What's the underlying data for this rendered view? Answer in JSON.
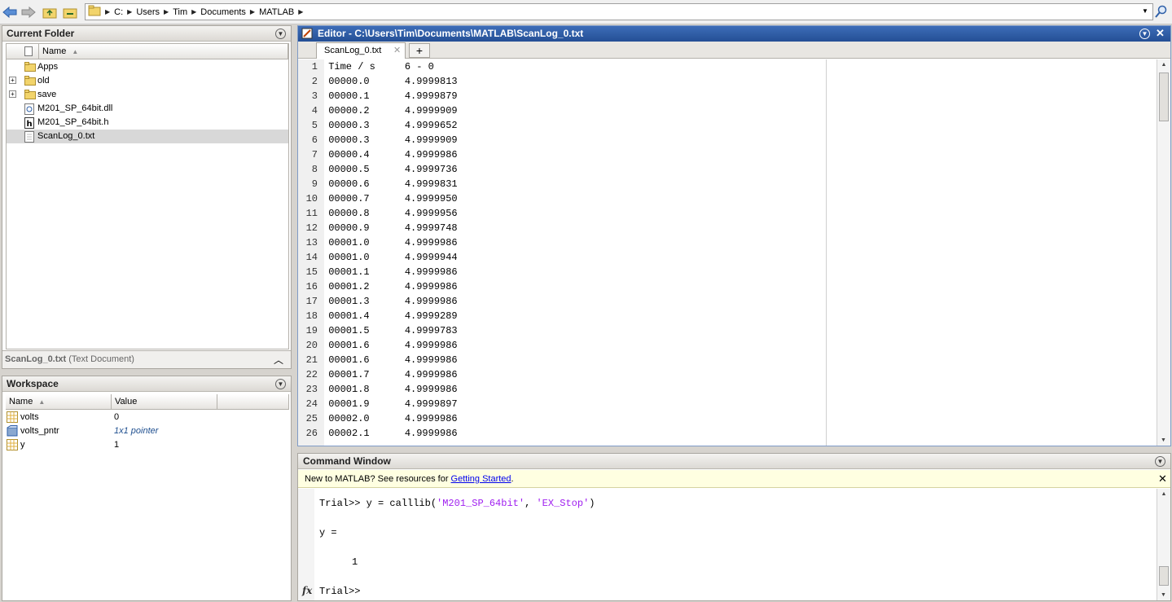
{
  "address": {
    "crumbs": [
      "C:",
      "Users",
      "Tim",
      "Documents",
      "MATLAB"
    ]
  },
  "current_folder": {
    "title": "Current Folder",
    "col_name": "Name",
    "items": [
      {
        "name": "Apps",
        "type": "folder",
        "expandable": false
      },
      {
        "name": "old",
        "type": "folder",
        "expandable": true
      },
      {
        "name": "save",
        "type": "folder",
        "expandable": true
      },
      {
        "name": "M201_SP_64bit.dll",
        "type": "dll",
        "expandable": false
      },
      {
        "name": "M201_SP_64bit.h",
        "type": "header",
        "expandable": false
      },
      {
        "name": "ScanLog_0.txt",
        "type": "text",
        "expandable": false
      }
    ],
    "details_file": "ScanLog_0.txt",
    "details_type": "(Text Document)"
  },
  "workspace": {
    "title": "Workspace",
    "col_name": "Name",
    "col_value": "Value",
    "vars": [
      {
        "name": "volts",
        "value": "0"
      },
      {
        "name": "volts_pntr",
        "value": "1x1 pointer"
      },
      {
        "name": "y",
        "value": "1"
      }
    ]
  },
  "editor": {
    "title": "Editor - C:\\Users\\Tim\\Documents\\MATLAB\\ScanLog_0.txt",
    "tab": "ScanLog_0.txt",
    "lines": [
      {
        "n": "1",
        "text": " Time / s     6 - 0"
      },
      {
        "n": "2",
        "text": " 00000.0      4.9999813"
      },
      {
        "n": "3",
        "text": " 00000.1      4.9999879"
      },
      {
        "n": "4",
        "text": " 00000.2      4.9999909"
      },
      {
        "n": "5",
        "text": " 00000.3      4.9999652"
      },
      {
        "n": "6",
        "text": " 00000.3      4.9999909"
      },
      {
        "n": "7",
        "text": " 00000.4      4.9999986"
      },
      {
        "n": "8",
        "text": " 00000.5      4.9999736"
      },
      {
        "n": "9",
        "text": " 00000.6      4.9999831"
      },
      {
        "n": "10",
        "text": " 00000.7      4.9999950"
      },
      {
        "n": "11",
        "text": " 00000.8      4.9999956"
      },
      {
        "n": "12",
        "text": " 00000.9      4.9999748"
      },
      {
        "n": "13",
        "text": " 00001.0      4.9999986"
      },
      {
        "n": "14",
        "text": " 00001.0      4.9999944"
      },
      {
        "n": "15",
        "text": " 00001.1      4.9999986"
      },
      {
        "n": "16",
        "text": " 00001.2      4.9999986"
      },
      {
        "n": "17",
        "text": " 00001.3      4.9999986"
      },
      {
        "n": "18",
        "text": " 00001.4      4.9999289"
      },
      {
        "n": "19",
        "text": " 00001.5      4.9999783"
      },
      {
        "n": "20",
        "text": " 00001.6      4.9999986"
      },
      {
        "n": "21",
        "text": " 00001.6      4.9999986"
      },
      {
        "n": "22",
        "text": " 00001.7      4.9999986"
      },
      {
        "n": "23",
        "text": " 00001.8      4.9999986"
      },
      {
        "n": "24",
        "text": " 00001.9      4.9999897"
      },
      {
        "n": "25",
        "text": " 00002.0      4.9999986"
      },
      {
        "n": "26",
        "text": " 00002.1      4.9999986"
      }
    ]
  },
  "command_window": {
    "title": "Command Window",
    "banner_prefix": "New to MATLAB? See resources for ",
    "banner_link": "Getting Started",
    "banner_suffix": ".",
    "cmd_prompt": "Trial>> ",
    "cmd_code": "y = calllib(",
    "cmd_arg1": "'M201_SP_64bit'",
    "cmd_comma": ", ",
    "cmd_arg2": "'EX_Stop'",
    "cmd_close": ")",
    "out_var": "y =",
    "out_val": "1",
    "prompt": "Trial>>",
    "fx": "fx"
  },
  "colors": {
    "string": "#a020f0",
    "editor_title_bg": "#2b5aa0",
    "banner_bg": "#ffffe1",
    "selection": "#d8d8d8"
  }
}
